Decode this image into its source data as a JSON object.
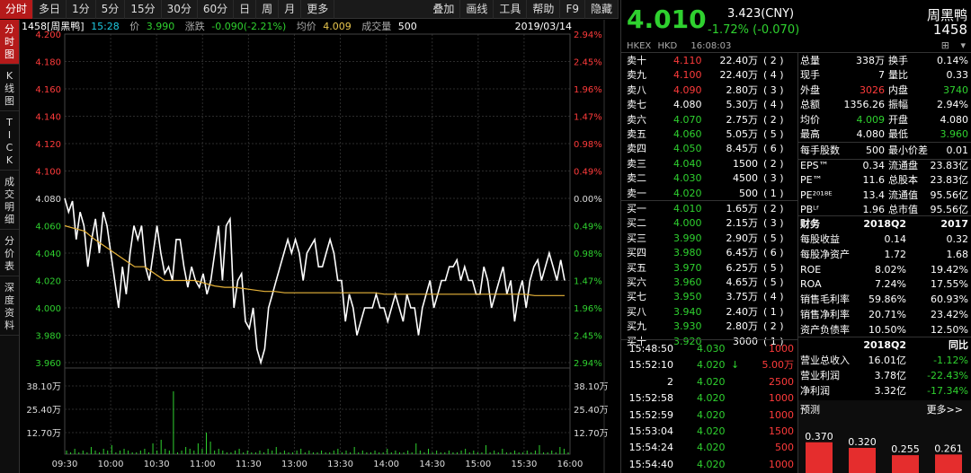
{
  "toolbar": {
    "left": [
      "分时",
      "多日",
      "1分",
      "5分",
      "15分",
      "30分",
      "60分",
      "日",
      "周",
      "月",
      "更多"
    ],
    "right": [
      "叠加",
      "画线",
      "工具",
      "帮助",
      "F9",
      "隐藏"
    ]
  },
  "left_tabs": [
    "分时图",
    "K线图",
    "TICK",
    "成交明细",
    "分价表",
    "深度资料"
  ],
  "info": {
    "name": "1458[周黑鸭]",
    "time": "15:28",
    "price_label": "价",
    "price": "3.990",
    "change_label": "涨跌",
    "change": "-0.090(-2.21%)",
    "avg_label": "均价",
    "avg": "4.009",
    "vol_label": "成交量",
    "vol": "500",
    "date": "2019/03/14"
  },
  "chart_data": {
    "type": "line",
    "x_ticks": [
      "09:30",
      "10:00",
      "10:30",
      "11:00",
      "11:30",
      "13:00",
      "13:30",
      "14:00",
      "14:30",
      "15:00",
      "15:30",
      "16:00"
    ],
    "y_ticks_left": [
      "4.200",
      "4.180",
      "4.160",
      "4.140",
      "4.120",
      "4.100",
      "4.080",
      "4.060",
      "4.040",
      "4.020",
      "4.000",
      "3.980",
      "3.960"
    ],
    "y_ticks_right": [
      "2.94%",
      "2.45%",
      "1.96%",
      "1.47%",
      "0.98%",
      "0.49%",
      "0.00%",
      "0.49%",
      "0.98%",
      "1.47%",
      "1.96%",
      "2.45%",
      "2.94%"
    ],
    "ylim": [
      3.96,
      4.2
    ],
    "prev_close": 4.08,
    "volume_ticks": [
      "38.10万",
      "25.40万",
      "12.70万"
    ],
    "series": [
      {
        "name": "价",
        "values": [
          4.08,
          4.07,
          4.078,
          4.05,
          4.07,
          4.06,
          4.03,
          4.05,
          4.065,
          4.04,
          4.07,
          4.06,
          4.04,
          4.02,
          4.0,
          4.03,
          4.01,
          4.04,
          4.06,
          4.05,
          4.06,
          4.03,
          4.02,
          4.04,
          4.06,
          4.04,
          4.025,
          4.03,
          4.02,
          4.05,
          4.05,
          4.03,
          4.015,
          4.03,
          4.02,
          4.015,
          4.025,
          4.01,
          4.02,
          4.04,
          4.06,
          4.02,
          4.06,
          4.065,
          4.0,
          4.02,
          4.025,
          3.99,
          3.985,
          4.0,
          3.97,
          3.96,
          3.97,
          4.0,
          4.01,
          4.02,
          4.03,
          4.04,
          4.05,
          4.04,
          4.05,
          4.04,
          4.02,
          4.04,
          4.045,
          4.05,
          4.03,
          4.03,
          4.04,
          4.05,
          4.04,
          4.02,
          4.02,
          3.99,
          4.01,
          4.0,
          3.98,
          3.99,
          4.0,
          4.0,
          4.0,
          4.01,
          4.0,
          4.0,
          3.99,
          4.0,
          4.01,
          4.0,
          3.99,
          4.01,
          4.0,
          4.0,
          3.98,
          4.0,
          4.01,
          4.02,
          4.0,
          4.01,
          4.02,
          4.02,
          4.03,
          4.03,
          4.035,
          4.02,
          4.03,
          4.02,
          4.02,
          4.01,
          4.01,
          4.03,
          4.02,
          4.0,
          4.01,
          4.02,
          4.03,
          4.01,
          4.02,
          3.99,
          4.01,
          4.02,
          4.0,
          4.02,
          4.03,
          4.035,
          4.02,
          4.03,
          4.04,
          4.03,
          4.02,
          4.035,
          4.02
        ]
      },
      {
        "name": "均价",
        "values": [
          4.06,
          4.058,
          4.056,
          4.05,
          4.045,
          4.04,
          4.035,
          4.03,
          4.03,
          4.025,
          4.02,
          4.02,
          4.02,
          4.02,
          4.018,
          4.016,
          4.015,
          4.015,
          4.014,
          4.013,
          4.012,
          4.012,
          4.011,
          4.011,
          4.011,
          4.011,
          4.011,
          4.011,
          4.011,
          4.011,
          4.011,
          4.011,
          4.01,
          4.01,
          4.01,
          4.01,
          4.01,
          4.01,
          4.01,
          4.01,
          4.01,
          4.01,
          4.01,
          4.01,
          4.01,
          4.01,
          4.01,
          4.009,
          4.009,
          4.009,
          4.009
        ]
      }
    ],
    "volume": [
      2,
      1,
      3,
      1,
      2,
      1,
      4,
      2,
      1,
      3,
      2,
      5,
      1,
      2,
      3,
      2,
      1,
      1,
      2,
      3,
      1,
      6,
      2,
      8,
      3,
      2,
      35,
      1,
      2,
      4,
      3,
      2,
      6,
      3,
      12,
      7,
      2,
      3,
      2,
      1,
      1,
      2,
      3,
      1,
      2,
      1,
      1,
      2,
      1,
      3,
      2,
      4,
      1,
      2,
      1,
      1,
      2,
      3,
      1,
      2,
      1,
      1,
      2,
      1,
      1,
      2,
      3,
      1,
      2,
      1,
      4,
      1,
      2,
      1,
      1,
      2,
      1,
      1,
      3,
      1,
      2,
      1,
      1,
      2,
      1,
      6,
      2,
      1,
      3,
      1,
      2,
      1,
      1,
      2,
      1,
      1,
      2,
      3,
      1,
      2,
      1,
      1,
      5,
      1,
      2,
      1,
      3,
      1,
      1,
      2,
      1,
      1,
      2,
      1,
      2,
      5,
      1,
      1,
      2,
      1,
      4,
      3,
      1
    ]
  },
  "quote": {
    "price": "4.010",
    "price_cny": "3.423(CNY)",
    "change": "-1.72% (-0.070)",
    "name": "周黑鸭",
    "code": "1458",
    "exchange": "HKEX",
    "currency": "HKD",
    "time": "16:08:03"
  },
  "asks": [
    {
      "label": "卖十",
      "price": "4.110",
      "vol": "22.40万",
      "n": "2"
    },
    {
      "label": "卖九",
      "price": "4.100",
      "vol": "22.40万",
      "n": "4"
    },
    {
      "label": "卖八",
      "price": "4.090",
      "vol": "2.80万",
      "n": "3"
    },
    {
      "label": "卖七",
      "price": "4.080",
      "vol": "5.30万",
      "n": "4"
    },
    {
      "label": "卖六",
      "price": "4.070",
      "vol": "2.75万",
      "n": "2"
    },
    {
      "label": "卖五",
      "price": "4.060",
      "vol": "5.05万",
      "n": "5"
    },
    {
      "label": "卖四",
      "price": "4.050",
      "vol": "8.45万",
      "n": "6"
    },
    {
      "label": "卖三",
      "price": "4.040",
      "vol": "1500",
      "n": "2"
    },
    {
      "label": "卖二",
      "price": "4.030",
      "vol": "4500",
      "n": "3"
    },
    {
      "label": "卖一",
      "price": "4.020",
      "vol": "500",
      "n": "1"
    }
  ],
  "bids": [
    {
      "label": "买一",
      "price": "4.010",
      "vol": "1.65万",
      "n": "2"
    },
    {
      "label": "买二",
      "price": "4.000",
      "vol": "2.15万",
      "n": "3"
    },
    {
      "label": "买三",
      "price": "3.990",
      "vol": "2.90万",
      "n": "5"
    },
    {
      "label": "买四",
      "price": "3.980",
      "vol": "6.45万",
      "n": "6"
    },
    {
      "label": "买五",
      "price": "3.970",
      "vol": "6.25万",
      "n": "5"
    },
    {
      "label": "买六",
      "price": "3.960",
      "vol": "4.65万",
      "n": "5"
    },
    {
      "label": "买七",
      "price": "3.950",
      "vol": "3.75万",
      "n": "4"
    },
    {
      "label": "买八",
      "price": "3.940",
      "vol": "2.40万",
      "n": "1"
    },
    {
      "label": "买九",
      "price": "3.930",
      "vol": "2.80万",
      "n": "2"
    },
    {
      "label": "买十",
      "price": "3.920",
      "vol": "3000",
      "n": "1"
    }
  ],
  "ticks": [
    {
      "time": "15:48:50",
      "price": "4.030",
      "vol": "1000"
    },
    {
      "time": "15:52:10",
      "price": "4.020",
      "arrow": "↓",
      "vol": "5.00万"
    },
    {
      "time": "2",
      "price": "4.020",
      "vol": "2500"
    },
    {
      "time": "15:52:58",
      "price": "4.020",
      "vol": "1000"
    },
    {
      "time": "15:52:59",
      "price": "4.020",
      "vol": "1000"
    },
    {
      "time": "15:53:04",
      "price": "4.020",
      "vol": "1500"
    },
    {
      "time": "15:54:24",
      "price": "4.020",
      "vol": "500"
    },
    {
      "time": "15:54:40",
      "price": "4.020",
      "vol": "1000"
    }
  ],
  "stats": [
    [
      "总量",
      "338万",
      "换手",
      "0.14%"
    ],
    [
      "现手",
      "7",
      "量比",
      "0.33"
    ],
    [
      "外盘",
      "3026",
      "内盘",
      "3740"
    ],
    [
      "总额",
      "1356.26",
      "振幅",
      "2.94%"
    ],
    [
      "均价",
      "4.009",
      "开盘",
      "4.080"
    ],
    [
      "最高",
      "4.080",
      "最低",
      "3.960"
    ],
    [
      "每手股数",
      "500",
      "最小价差",
      "0.01"
    ],
    [
      "EPS™",
      "0.34",
      "流通盘",
      "23.83亿"
    ],
    [
      "PE™",
      "11.6",
      "总股本",
      "23.83亿"
    ],
    [
      "PE²⁰¹⁸ᴱ",
      "13.4",
      "流通值",
      "95.56亿"
    ],
    [
      "PBᴸᶠ",
      "1.96",
      "总市值",
      "95.56亿"
    ]
  ],
  "finance": {
    "header": [
      "财务",
      "2018Q2",
      "2017"
    ],
    "rows": [
      [
        "每股收益",
        "0.14",
        "0.32"
      ],
      [
        "每股净资产",
        "1.72",
        "1.68"
      ],
      [
        "ROE",
        "8.02%",
        "19.42%"
      ],
      [
        "ROA",
        "7.24%",
        "17.55%"
      ],
      [
        "销售毛利率",
        "59.86%",
        "60.93%"
      ],
      [
        "销售净利率",
        "20.71%",
        "23.42%"
      ],
      [
        "资产负债率",
        "10.50%",
        "12.50%"
      ]
    ],
    "header2": [
      "",
      "2018Q2",
      "同比"
    ],
    "rows2": [
      [
        "营业总收入",
        "16.01亿",
        "-1.12%"
      ],
      [
        "营业利润",
        "3.78亿",
        "-22.43%"
      ],
      [
        "净利润",
        "3.32亿",
        "-17.34%"
      ]
    ]
  },
  "forecast": {
    "title": "预测",
    "more": "更多>>",
    "values": [
      "0.370",
      "0.320",
      "0.255",
      "0.261"
    ],
    "levels": [
      0.37,
      0.32,
      0.255,
      0.261
    ]
  },
  "colors": {
    "up": "#ff3b3b",
    "down": "#2fd12f",
    "price_line": "#ffffff",
    "avg_line": "#e8b43a",
    "accent": "#b51a1a"
  }
}
